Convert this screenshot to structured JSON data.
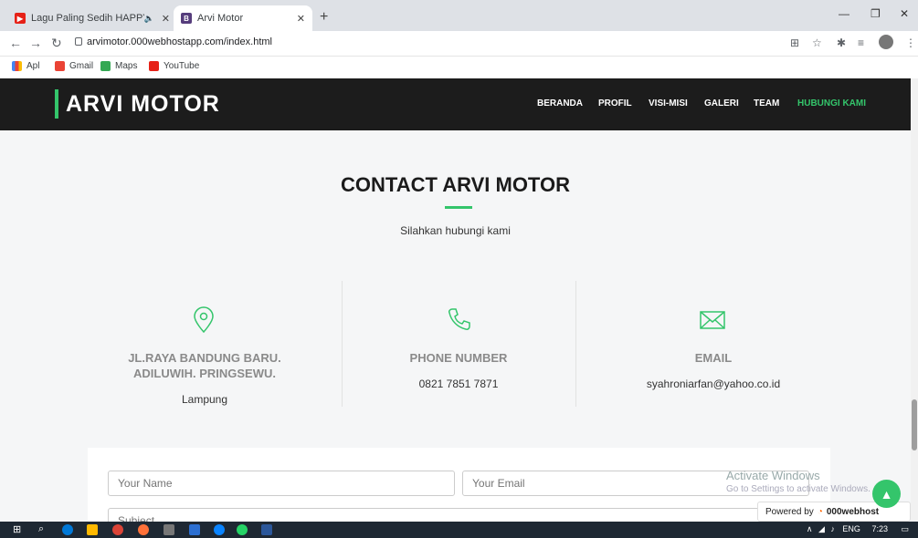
{
  "browser": {
    "tabs": [
      {
        "title": "Lagu Paling Sedih HAPPY AS",
        "favicon_color": "#e62117"
      },
      {
        "title": "Arvi Motor",
        "favicon_color": "#563d7c",
        "favicon_letter": "B"
      }
    ],
    "url": "arvimotor.000webhostapp.com/index.html",
    "bookmarks": [
      "Apl",
      "Gmail",
      "Maps",
      "YouTube"
    ]
  },
  "site": {
    "logo": "ARVI MOTOR",
    "menu": [
      "BERANDA",
      "PROFIL",
      "VISI-MISI",
      "GALERI",
      "TEAM",
      "HUBUNGI KAMI"
    ],
    "active_menu": "HUBUNGI KAMI",
    "accent_color": "#34c56b"
  },
  "contact": {
    "title": "CONTACT ARVI MOTOR",
    "subtitle": "Silahkan hubungi kami",
    "address_title_line1": "JL.RAYA BANDUNG BARU.",
    "address_title_line2": "ADILUWIH. PRINGSEWU.",
    "address_value": "Lampung",
    "phone_title": "PHONE NUMBER",
    "phone_value": "0821 7851 7871",
    "email_title": "EMAIL",
    "email_value": "syahroniarfan@yahoo.co.id"
  },
  "form": {
    "name_placeholder": "Your Name",
    "email_placeholder": "Your Email",
    "subject_placeholder": "Subject"
  },
  "overlay": {
    "watermark_title": "Activate Windows",
    "watermark_sub": "Go to Settings to activate Windows.",
    "powered_by": "Powered by",
    "powered_brand": "000webhost"
  },
  "taskbar": {
    "lang": "ENG",
    "time": "7:23"
  }
}
